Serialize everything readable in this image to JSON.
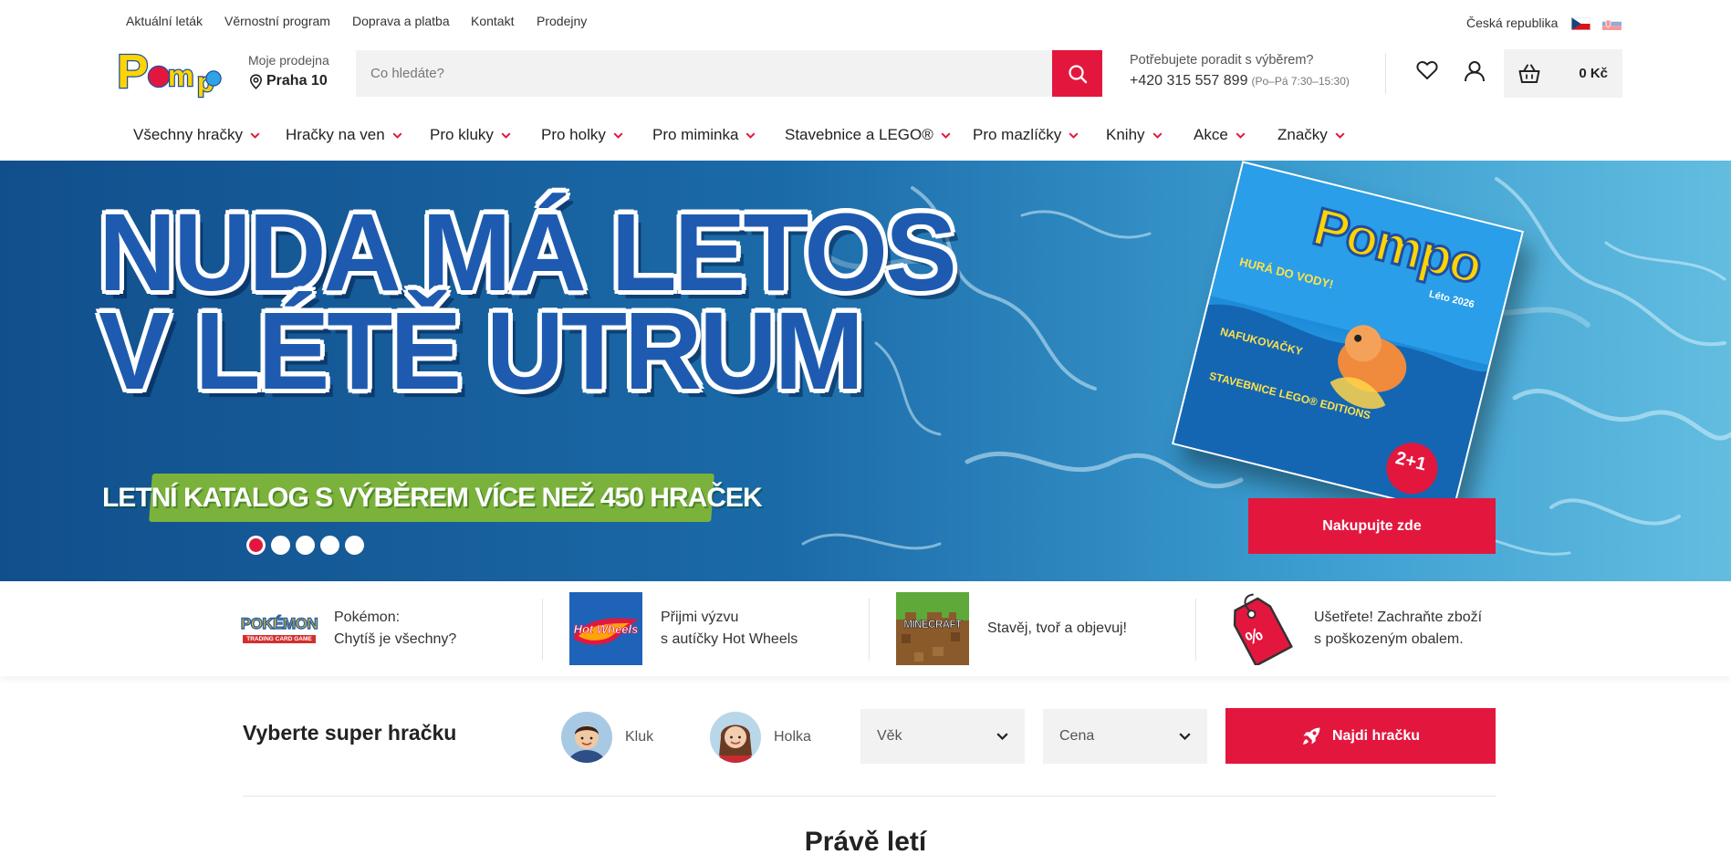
{
  "topbar": {
    "links": [
      "Aktuální leták",
      "Věrnostní program",
      "Doprava a platba",
      "Kontakt",
      "Prodejny"
    ],
    "country": "Česká republika"
  },
  "header": {
    "logo_text": "Pompo",
    "store_label": "Moje prodejna",
    "store_value": "Praha 10",
    "search_placeholder": "Co hledáte?",
    "help_question": "Potřebujete poradit s výběrem?",
    "help_phone": "+420 315 557 899",
    "help_hours": "(Po–Pá 7:30–15:30)",
    "cart_total": "0 Kč",
    "icons": [
      "heart-icon",
      "user-icon",
      "basket-icon",
      "search-icon",
      "map-pin-icon"
    ]
  },
  "nav": {
    "items": [
      "Všechny hračky",
      "Hračky na ven",
      "Pro kluky",
      "Pro holky",
      "Pro miminka",
      "Stavebnice a LEGO®",
      "Pro mazlíčky",
      "Knihy",
      "Akce",
      "Značky"
    ]
  },
  "hero": {
    "line1": "NUDA MÁ LETOS",
    "line2": "V LÉTĚ UTRUM",
    "ribbon": "LETNÍ KATALOG S VÝBĚREM VÍCE NEŽ 450 HRAČEK",
    "cta": "Nakupujte zde",
    "slide_count": 5,
    "active_slide": 1,
    "catalog": {
      "brand": "Pompo",
      "season": "Léto 2026",
      "headline": "HURÁ DO VODY!",
      "sub1": "NAFUKOVAČKY",
      "sub2": "STAVEBNICE LEGO® EDITIONS",
      "badge": "2+1"
    }
  },
  "promos": [
    {
      "line1": "Pokémon:",
      "line2": "Chytíš je všechny?",
      "logo_text": "POKÉMON",
      "logo_sub": "TRADING CARD GAME"
    },
    {
      "line1": "Přijmi výzvu",
      "line2": "s autíčky Hot Wheels",
      "logo_text": "Hot Wheels"
    },
    {
      "line1": "Stavěj, tvoř a objevuj!",
      "line2": "",
      "logo_text": "MINECRAFT"
    },
    {
      "line1": "Ušetřete! Zachraňte zboží",
      "line2": "s poškozeným obalem.",
      "logo_text": "%"
    }
  ],
  "filter": {
    "title": "Vyberte super hračku",
    "boy": "Kluk",
    "girl": "Holka",
    "age": "Věk",
    "price": "Cena",
    "button": "Najdi hračku"
  },
  "section": {
    "title": "Právě letí"
  },
  "colors": {
    "accent": "#e3173e",
    "hero_blue": "#1e5bb0",
    "ribbon_green": "#7bb23c",
    "field_bg": "#f2f2f2"
  }
}
